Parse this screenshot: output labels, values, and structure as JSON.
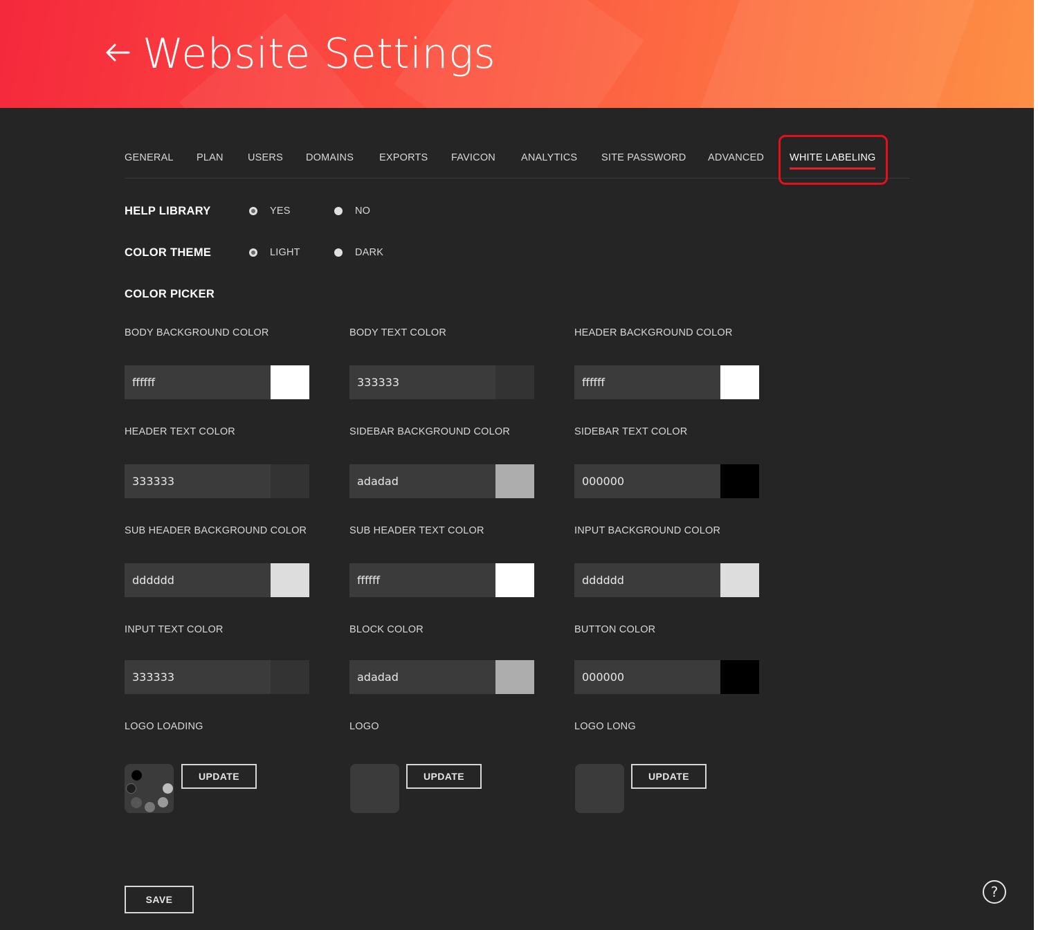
{
  "header": {
    "title": "Website Settings",
    "back_icon": "arrow-left-icon"
  },
  "tabs": [
    {
      "label": "GENERAL",
      "active": false
    },
    {
      "label": "PLAN",
      "active": false
    },
    {
      "label": "USERS",
      "active": false
    },
    {
      "label": "DOMAINS",
      "active": false
    },
    {
      "label": "EXPORTS",
      "active": false
    },
    {
      "label": "FAVICON",
      "active": false
    },
    {
      "label": "ANALYTICS",
      "active": false
    },
    {
      "label": "SITE PASSWORD",
      "active": false
    },
    {
      "label": "ADVANCED",
      "active": false
    },
    {
      "label": "WHITE LABELING",
      "active": true
    }
  ],
  "help_library": {
    "label": "HELP LIBRARY",
    "options": [
      {
        "label": "YES",
        "selected": true
      },
      {
        "label": "NO",
        "selected": false
      }
    ]
  },
  "color_theme": {
    "label": "COLOR THEME",
    "options": [
      {
        "label": "LIGHT",
        "selected": true
      },
      {
        "label": "DARK",
        "selected": false
      }
    ]
  },
  "color_picker": {
    "label": "COLOR PICKER",
    "fields": [
      {
        "label": "BODY BACKGROUND COLOR",
        "value": "ffffff",
        "color": "#ffffff"
      },
      {
        "label": "BODY TEXT COLOR",
        "value": "333333",
        "color": "#333333"
      },
      {
        "label": "HEADER BACKGROUND COLOR",
        "value": "ffffff",
        "color": "#ffffff"
      },
      {
        "label": "HEADER TEXT COLOR",
        "value": "333333",
        "color": "#333333"
      },
      {
        "label": "SIDEBAR BACKGROUND COLOR",
        "value": "adadad",
        "color": "#adadad"
      },
      {
        "label": "SIDEBAR TEXT COLOR",
        "value": "000000",
        "color": "#000000"
      },
      {
        "label": "SUB HEADER BACKGROUND COLOR",
        "value": "dddddd",
        "color": "#dddddd"
      },
      {
        "label": "SUB HEADER TEXT COLOR",
        "value": "ffffff",
        "color": "#ffffff"
      },
      {
        "label": "INPUT BACKGROUND COLOR",
        "value": "dddddd",
        "color": "#dddddd"
      },
      {
        "label": "INPUT TEXT COLOR",
        "value": "333333",
        "color": "#333333"
      },
      {
        "label": "BLOCK COLOR",
        "value": "adadad",
        "color": "#adadad"
      },
      {
        "label": "BUTTON COLOR",
        "value": "000000",
        "color": "#000000"
      }
    ]
  },
  "logos": [
    {
      "label": "LOGO LOADING",
      "button": "UPDATE",
      "thumbnail": "loading-spinner-icon"
    },
    {
      "label": "LOGO",
      "button": "UPDATE",
      "thumbnail": "empty"
    },
    {
      "label": "LOGO LONG",
      "button": "UPDATE",
      "thumbnail": "empty"
    }
  ],
  "save_label": "SAVE",
  "help_button": {
    "label": "?",
    "icon": "help-circle-icon"
  },
  "colors": {
    "accent": "#e3212f",
    "banner_start": "#f5283c",
    "banner_end": "#fd8f45",
    "background": "#252525"
  }
}
